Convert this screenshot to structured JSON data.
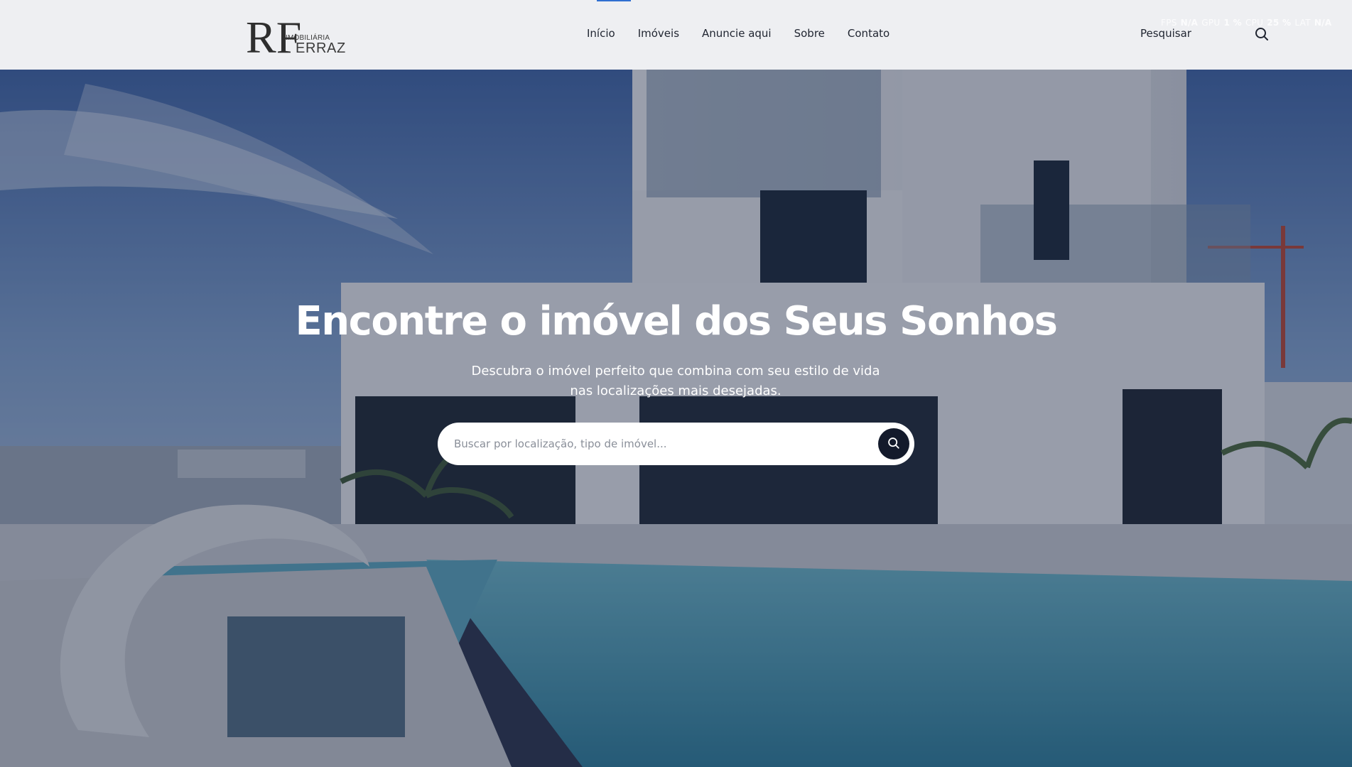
{
  "logo": {
    "monogram": "RF",
    "subtitle": "IMOBILIÁRIA",
    "name": "ERRAZ"
  },
  "nav": {
    "items": [
      {
        "label": "Início"
      },
      {
        "label": "Imóveis"
      },
      {
        "label": "Anuncie aqui"
      },
      {
        "label": "Sobre"
      },
      {
        "label": "Contato"
      }
    ]
  },
  "header_search": {
    "label": "Pesquisar",
    "icon": "search-icon"
  },
  "perf_overlay": {
    "fps_label": "FPS",
    "fps_value": "N/A",
    "gpu_label": "GPU",
    "gpu_value": "1 %",
    "cpu_label": "CPU",
    "cpu_value": "25 %",
    "lat_label": "LAT",
    "lat_value": "N/A"
  },
  "hero": {
    "title": "Encontre o imóvel dos Seus Sonhos",
    "subtitle": "Descubra o imóvel perfeito que combina com seu estilo de vida nas localizações mais desejadas.",
    "search": {
      "placeholder": "Buscar por localização, tipo de imóvel...",
      "value": "",
      "button_icon": "search-icon"
    }
  },
  "colors": {
    "header_bg": "#eeeff2",
    "nav_active_indicator": "#2f6fd1",
    "search_button_bg": "#131a2b",
    "text_dark": "#1f2430",
    "hero_text": "#ffffff"
  }
}
